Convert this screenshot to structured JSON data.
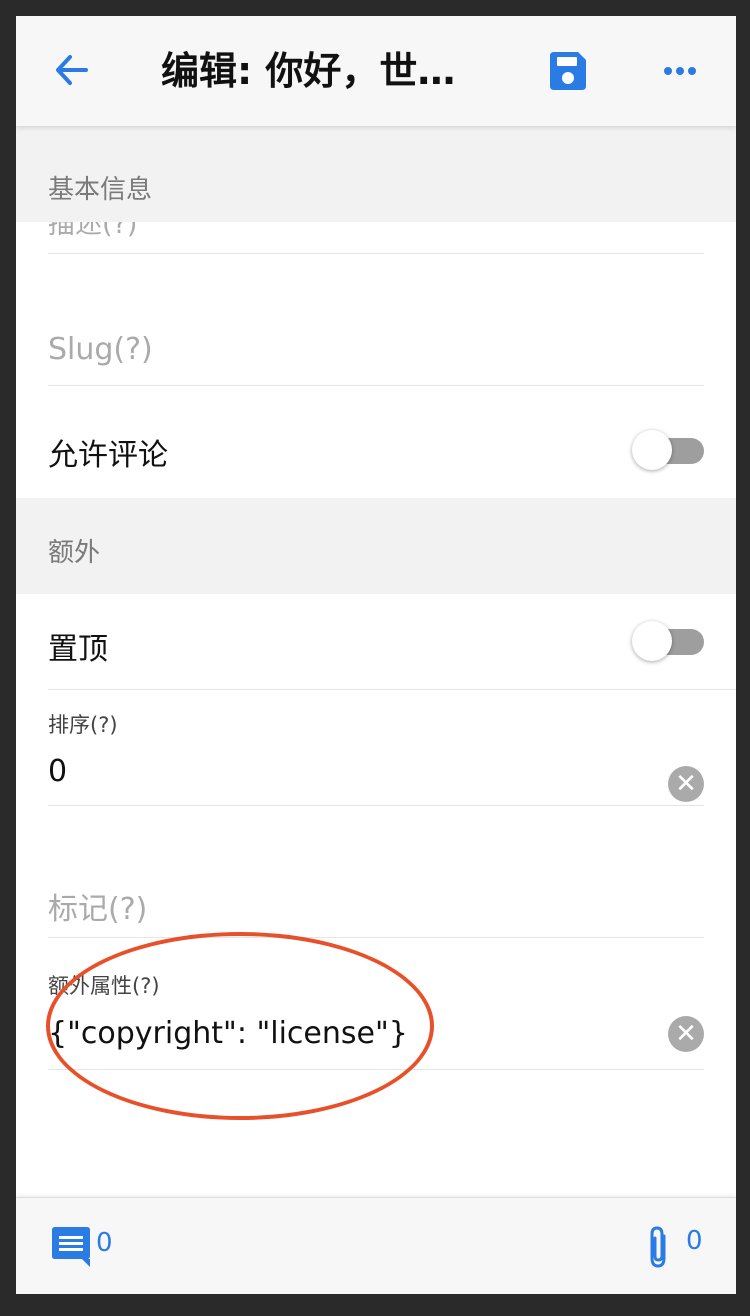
{
  "header": {
    "title": "编辑: 你好，世…",
    "accent_color": "#2a7be4",
    "icons": {
      "back": "arrow-left-icon",
      "save": "floppy-disk-icon",
      "more": "more-horizontal-icon"
    }
  },
  "sections": {
    "basic": {
      "title": "基本信息"
    },
    "extra": {
      "title": "额外"
    }
  },
  "fields": {
    "description_partial": "描述(?)",
    "slug_placeholder": "Slug(?)",
    "allow_comments": {
      "label": "允许评论",
      "on": false
    },
    "sticky": {
      "label": "置顶",
      "on": false
    },
    "order": {
      "label": "排序(?)",
      "value": "0"
    },
    "tags_placeholder": "标记(?)",
    "extra_attrs": {
      "label": "额外属性(?)",
      "value": "{\"copyright\": \"license\"}"
    }
  },
  "footer": {
    "comment_count": "0",
    "attachment_count": "0",
    "icons": {
      "comments": "comment-icon",
      "attachments": "paperclip-icon"
    }
  },
  "annotation_color": "#e8502a"
}
